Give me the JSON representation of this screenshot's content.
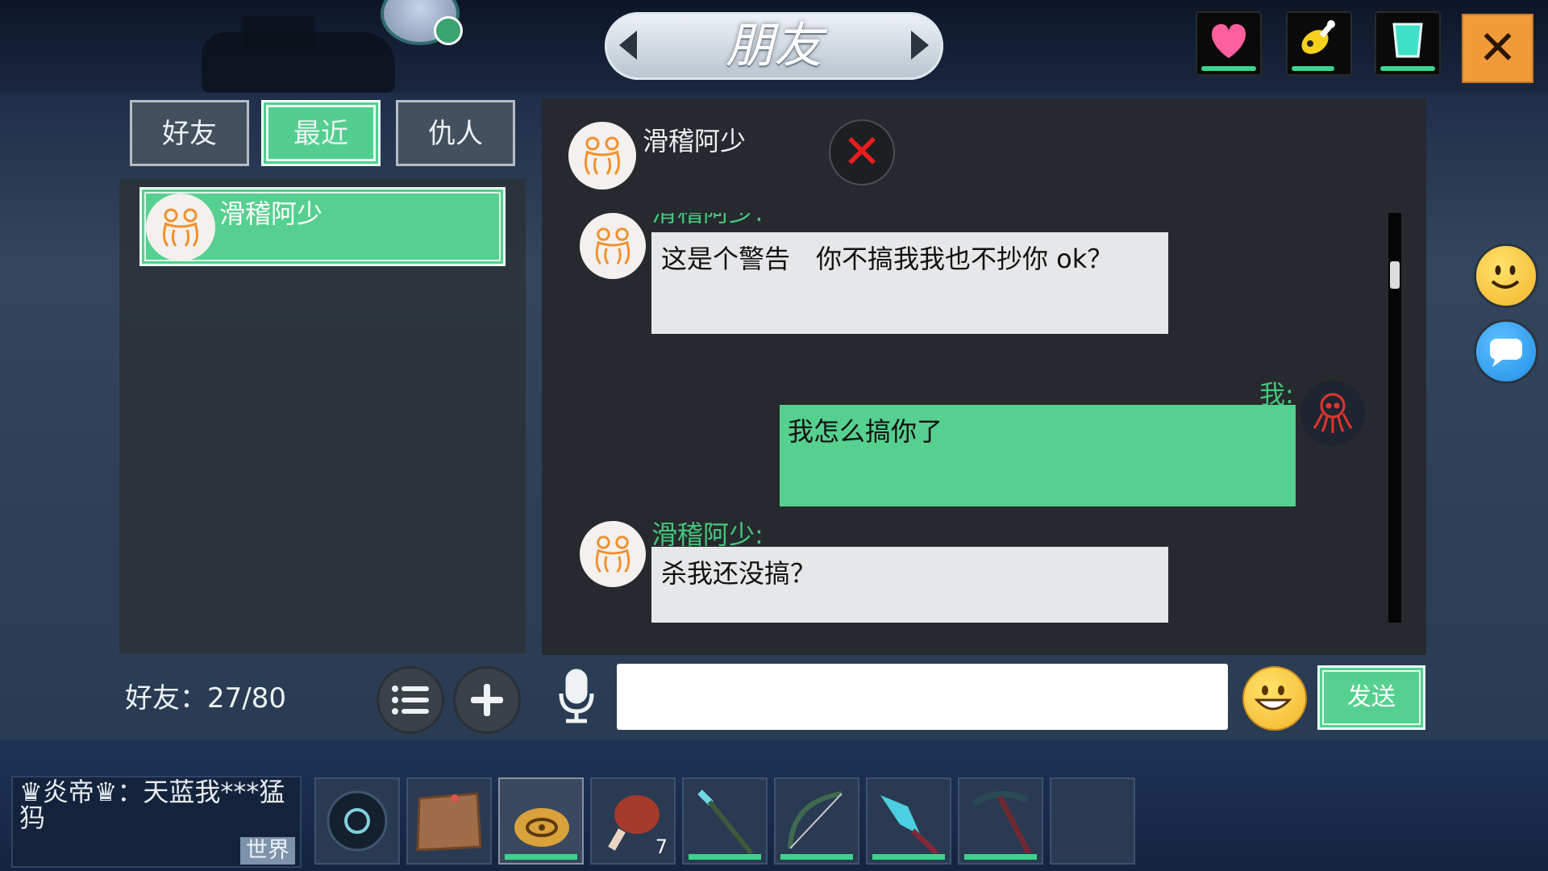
{
  "header": {
    "title": "朋友",
    "close_label": "✕",
    "stats": [
      {
        "icon": "heart-icon",
        "color": "#ff5f9c"
      },
      {
        "icon": "drumstick-icon",
        "color": "#f6d11b"
      },
      {
        "icon": "water-cup-icon",
        "color": "#3fe0c8"
      }
    ]
  },
  "tabs": [
    {
      "label": "好友",
      "active": false
    },
    {
      "label": "最近",
      "active": true
    },
    {
      "label": "仇人",
      "active": false
    }
  ],
  "friend_list": [
    {
      "name": "滑稽阿少",
      "avatar": "frog-icon"
    }
  ],
  "friend_count": "好友：27/80",
  "chat": {
    "partner_name": "滑稽阿少",
    "messages": [
      {
        "sender": "滑稽阿少:",
        "text": "这是个警告　你不搞我我也不抄你 ok？",
        "side": "left"
      },
      {
        "sender": "我:",
        "text": "我怎么搞你了",
        "side": "right"
      },
      {
        "sender": "滑稽阿少:",
        "text": "杀我还没搞？",
        "side": "left"
      }
    ],
    "input_value": "",
    "send_label": "发送"
  },
  "world_chat": {
    "text": "♛炎帝♛：天蓝我***猛犸",
    "channel_label": "世界"
  },
  "hotbar": [
    {
      "item": "dark-orb-icon",
      "count": ""
    },
    {
      "item": "treasure-map-icon",
      "count": ""
    },
    {
      "item": "water-gourd-icon",
      "count": ""
    },
    {
      "item": "roast-meat-icon",
      "count": "7"
    },
    {
      "item": "spear-icon",
      "count": ""
    },
    {
      "item": "bow-icon",
      "count": ""
    },
    {
      "item": "crystal-blade-icon",
      "count": ""
    },
    {
      "item": "pickaxe-icon",
      "count": ""
    },
    {
      "item": "empty-slot",
      "count": ""
    }
  ]
}
